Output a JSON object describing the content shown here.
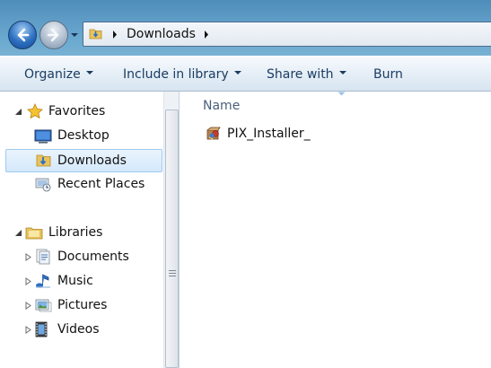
{
  "address": {
    "path": [
      "Downloads"
    ]
  },
  "toolbar": {
    "organize": "Organize",
    "include": "Include in library",
    "share": "Share with",
    "burn": "Burn"
  },
  "nav": {
    "favorites": "Favorites",
    "desktop": "Desktop",
    "downloads": "Downloads",
    "recent": "Recent Places",
    "libraries": "Libraries",
    "documents": "Documents",
    "music": "Music",
    "pictures": "Pictures",
    "videos": "Videos"
  },
  "files": {
    "column_name": "Name",
    "items": [
      {
        "name": "PIX_Installer_",
        "icon": "installer-icon"
      }
    ]
  },
  "colors": {
    "titlebar": "#5e9cc6",
    "command_text": "#1b3c62",
    "selected_bg": "#d4e8fb",
    "selected_border": "#9fcaf0"
  }
}
